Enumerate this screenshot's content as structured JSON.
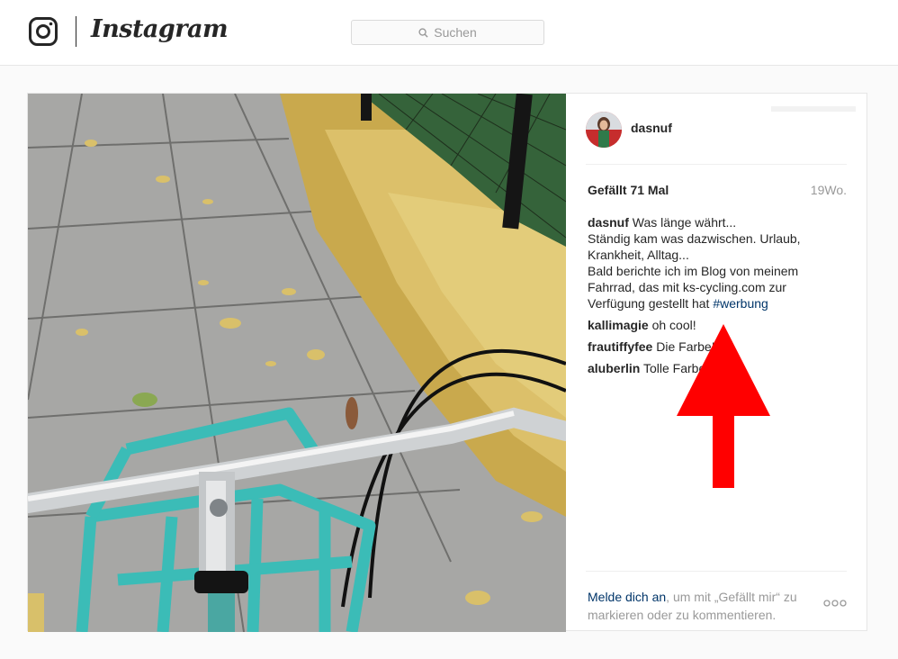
{
  "header": {
    "logo_text": "Instagram",
    "search_placeholder": "Suchen"
  },
  "post": {
    "username": "dasnuf",
    "likes": "Gefällt 71 Mal",
    "time_ago": "19Wo.",
    "caption": {
      "user": "dasnuf",
      "line1": "Was länge währt...",
      "line2": "Ständig kam was dazwischen. Urlaub, Krankheit, Alltag...",
      "line3": "Bald berichte ich im Blog von meinem Fahrrad, das mit ks-cycling.com zur Verfügung gestellt hat",
      "hashtag": "#werbung"
    },
    "comments": [
      {
        "user": "kallimagie",
        "text": "oh cool!"
      },
      {
        "user": "frautiffyfee",
        "text": "Die Farbe!"
      },
      {
        "user": "aluberlin",
        "text": "Tolle Farben"
      }
    ],
    "login_link": "Melde dich an",
    "login_rest": ", um mit „Gefällt mir“ zu markieren oder zu kommentieren."
  },
  "icons": {
    "camera": "instagram-camera-icon",
    "search": "search-icon",
    "more": "more-options-icon",
    "emoji": "heart-eyes-emoji-icon"
  },
  "colors": {
    "link": "#003569",
    "arrow": "#ff0000",
    "basket": "#3bbcb7"
  }
}
